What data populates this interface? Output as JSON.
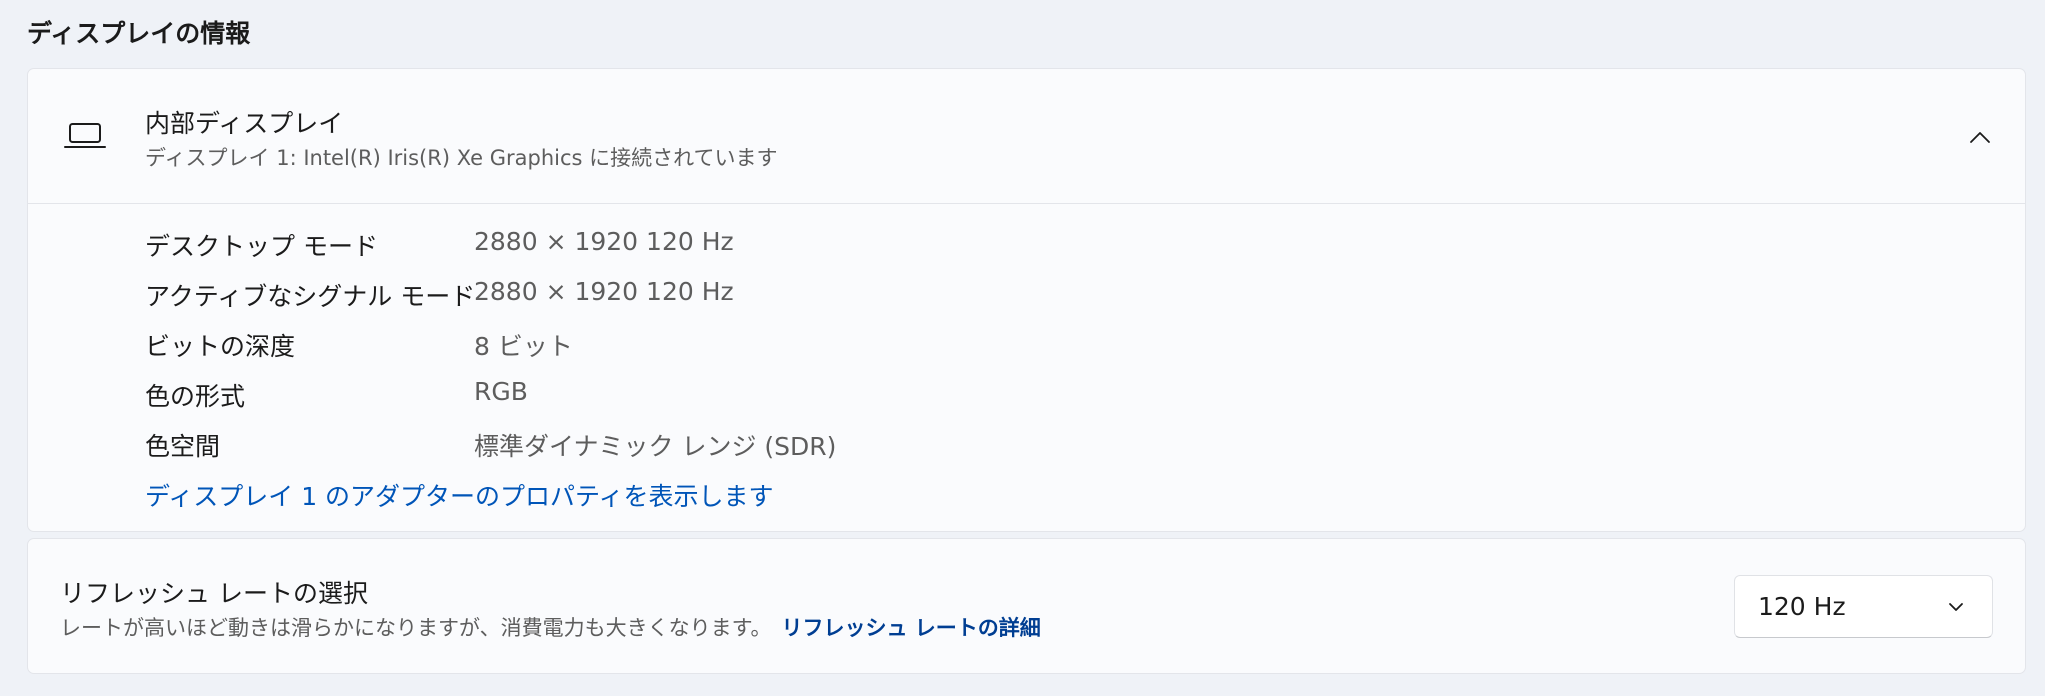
{
  "section": {
    "title": "ディスプレイの情報"
  },
  "display_card": {
    "title": "内部ディスプレイ",
    "subtitle": "ディスプレイ 1: Intel(R) Iris(R) Xe Graphics に接続されています",
    "icon": "laptop-icon",
    "expand_icon": "chevron-up-icon",
    "properties": [
      {
        "label": "デスクトップ モード",
        "value": "2880 × 1920 120 Hz"
      },
      {
        "label": "アクティブなシグナル モード",
        "value": "2880 × 1920 120 Hz"
      },
      {
        "label": "ビットの深度",
        "value": "8 ビット"
      },
      {
        "label": "色の形式",
        "value": "RGB"
      },
      {
        "label": "色空間",
        "value": "標準ダイナミック レンジ (SDR)"
      }
    ],
    "adapter_link": "ディスプレイ 1 のアダプターのプロパティを表示します"
  },
  "refresh_card": {
    "title": "リフレッシュ レートの選択",
    "description": "レートが高いほど動きは滑らかになりますが、消費電力も大きくなります。",
    "details_link": "リフレッシュ レートの詳細",
    "selected_rate": "120 Hz",
    "dropdown_icon": "chevron-down-icon"
  },
  "colors": {
    "background": "#eff2f7",
    "card": "#fafbfd",
    "link": "#0055b8",
    "secondary_text": "#5d5d5d"
  }
}
